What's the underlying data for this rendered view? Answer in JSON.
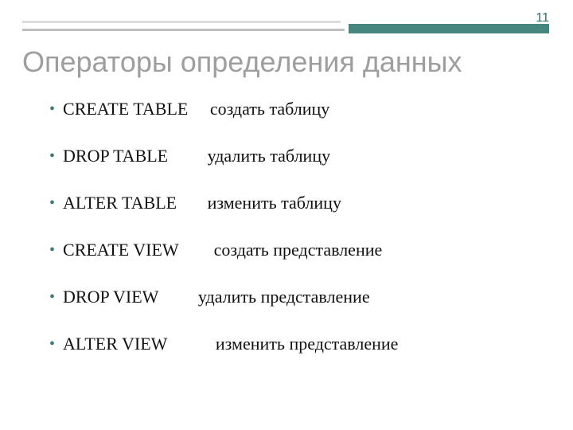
{
  "slide": {
    "page_number": "11",
    "title": "Операторы определения данных",
    "items": [
      {
        "operator": "CREATE TABLE",
        "gap": "     ",
        "description": "создать таблицу"
      },
      {
        "operator": "DROP TABLE",
        "gap": "         ",
        "description": "удалить таблицу"
      },
      {
        "operator": "ALTER TABLE",
        "gap": "       ",
        "description": "изменить таблицу"
      },
      {
        "operator": "CREATE VIEW",
        "gap": "        ",
        "description": "создать представление"
      },
      {
        "operator": "DROP VIEW",
        "gap": "         ",
        "description": "удалить представление"
      },
      {
        "operator": "ALTER VIEW",
        "gap": "           ",
        "description": "изменить представление"
      }
    ]
  }
}
